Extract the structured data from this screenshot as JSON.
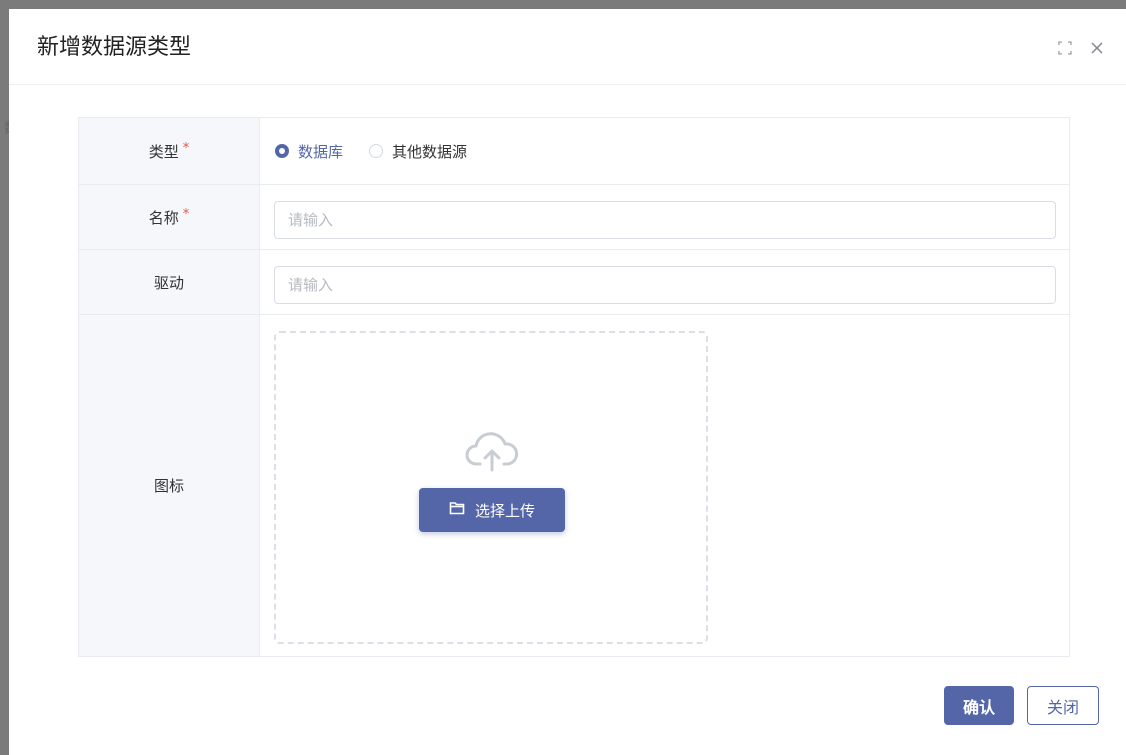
{
  "dialog": {
    "title": "新增数据源类型",
    "fullscreen_icon": "fullscreen-icon",
    "close_icon": "close-icon"
  },
  "backdrop": {
    "partial_text": "数"
  },
  "form": {
    "type": {
      "label": "类型",
      "required_mark": "*",
      "options": [
        {
          "label": "数据库",
          "checked": true
        },
        {
          "label": "其他数据源",
          "checked": false
        }
      ]
    },
    "name": {
      "label": "名称",
      "required_mark": "*",
      "value": "",
      "placeholder": "请输入"
    },
    "driver": {
      "label": "驱动",
      "value": "",
      "placeholder": "请输入"
    },
    "icon": {
      "label": "图标",
      "upload_icon": "cloud-upload-icon",
      "upload_button_icon": "folder-icon",
      "upload_button_label": "选择上传"
    }
  },
  "footer": {
    "confirm_label": "确认",
    "close_label": "关闭"
  },
  "colors": {
    "primary": "#5466a8",
    "required": "#e4514b",
    "label_bg": "#f5f7fb"
  }
}
